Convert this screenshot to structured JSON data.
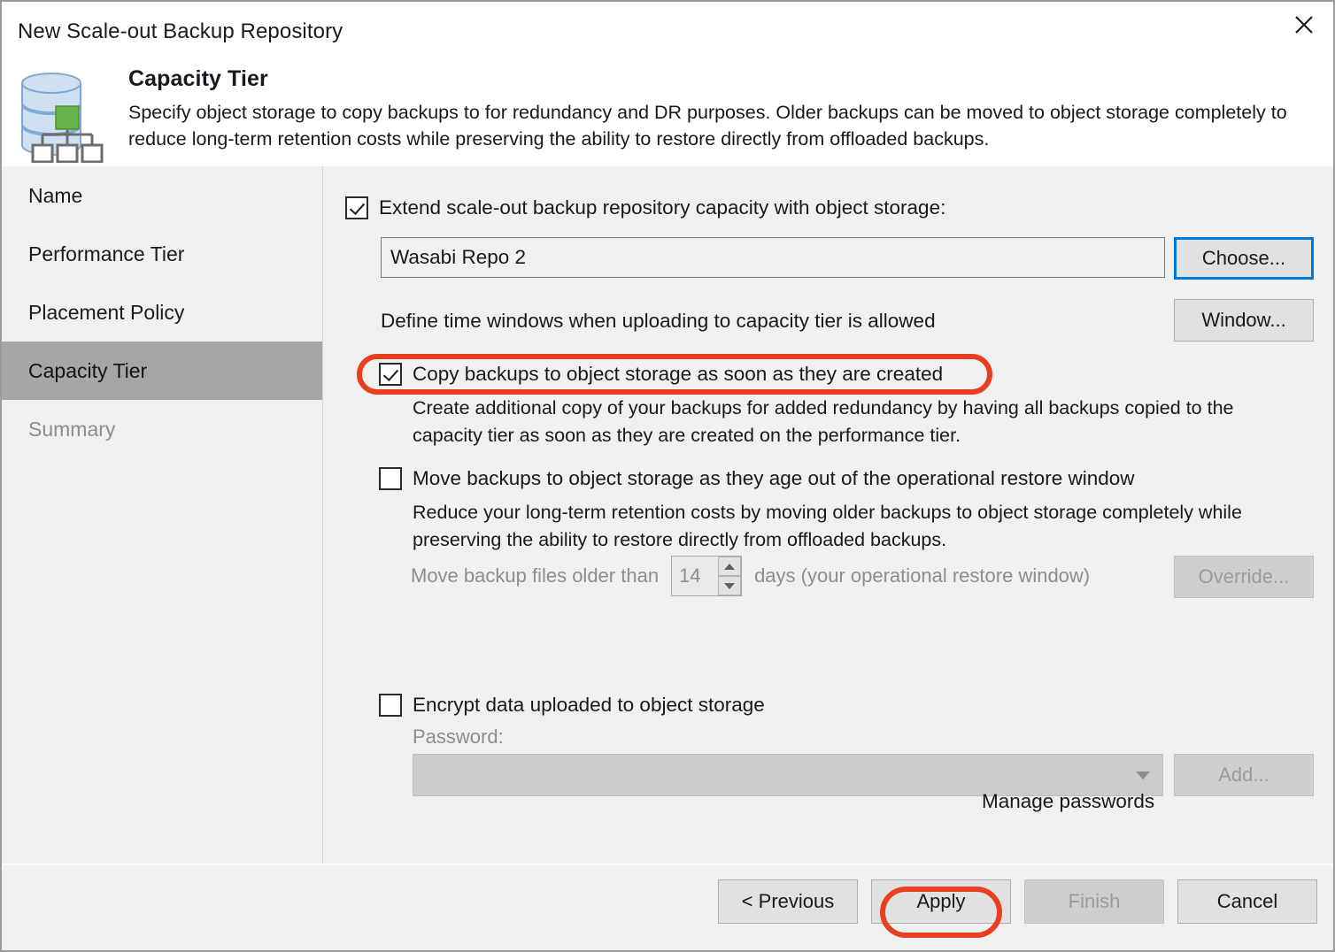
{
  "window": {
    "title": "New Scale-out Backup Repository",
    "close_icon": "close-icon"
  },
  "header": {
    "icon": "scale-out-repository-icon",
    "title": "Capacity Tier",
    "description": "Specify object storage to copy backups to for redundancy and DR purposes. Older backups can be moved to object storage completely to reduce long-term retention costs while preserving the ability to restore directly from offloaded backups."
  },
  "sidebar": {
    "items": [
      {
        "label": "Name",
        "state": "normal"
      },
      {
        "label": "Performance Tier",
        "state": "normal"
      },
      {
        "label": "Placement Policy",
        "state": "normal"
      },
      {
        "label": "Capacity Tier",
        "state": "selected"
      },
      {
        "label": "Summary",
        "state": "disabled"
      }
    ]
  },
  "main": {
    "extend": {
      "checked": true,
      "label": "Extend scale-out backup repository capacity with object storage:",
      "repository_value": "Wasabi Repo 2",
      "choose_button": "Choose..."
    },
    "time_window": {
      "label": "Define time windows when uploading to capacity tier is allowed",
      "window_button": "Window..."
    },
    "copy_backups": {
      "checked": true,
      "label": "Copy backups to object storage as soon as they are created",
      "description": "Create additional copy of your backups for added redundancy by having all backups copied to the capacity tier as soon as they are created on the performance tier."
    },
    "move_backups": {
      "checked": false,
      "label": "Move backups to object storage as they age out of the operational restore window",
      "description": "Reduce your long-term retention costs by moving older backups to object storage completely while preserving the ability to restore directly from offloaded backups.",
      "older_than_prefix": "Move backup files older than",
      "days_value": "14",
      "older_than_suffix": "days (your operational restore window)",
      "override_button": "Override...",
      "override_disabled": true
    },
    "encrypt": {
      "checked": false,
      "label": "Encrypt data uploaded to object storage",
      "password_label": "Password:",
      "password_value": "",
      "add_button": "Add...",
      "add_disabled": true,
      "manage_passwords_link": "Manage passwords"
    }
  },
  "footer": {
    "previous": "< Previous",
    "apply": "Apply",
    "finish": "Finish",
    "cancel": "Cancel",
    "finish_disabled": true
  },
  "annotations": {
    "color": "#e8401f",
    "targets": [
      "copy-backups-checkbox-row",
      "apply-button"
    ]
  }
}
